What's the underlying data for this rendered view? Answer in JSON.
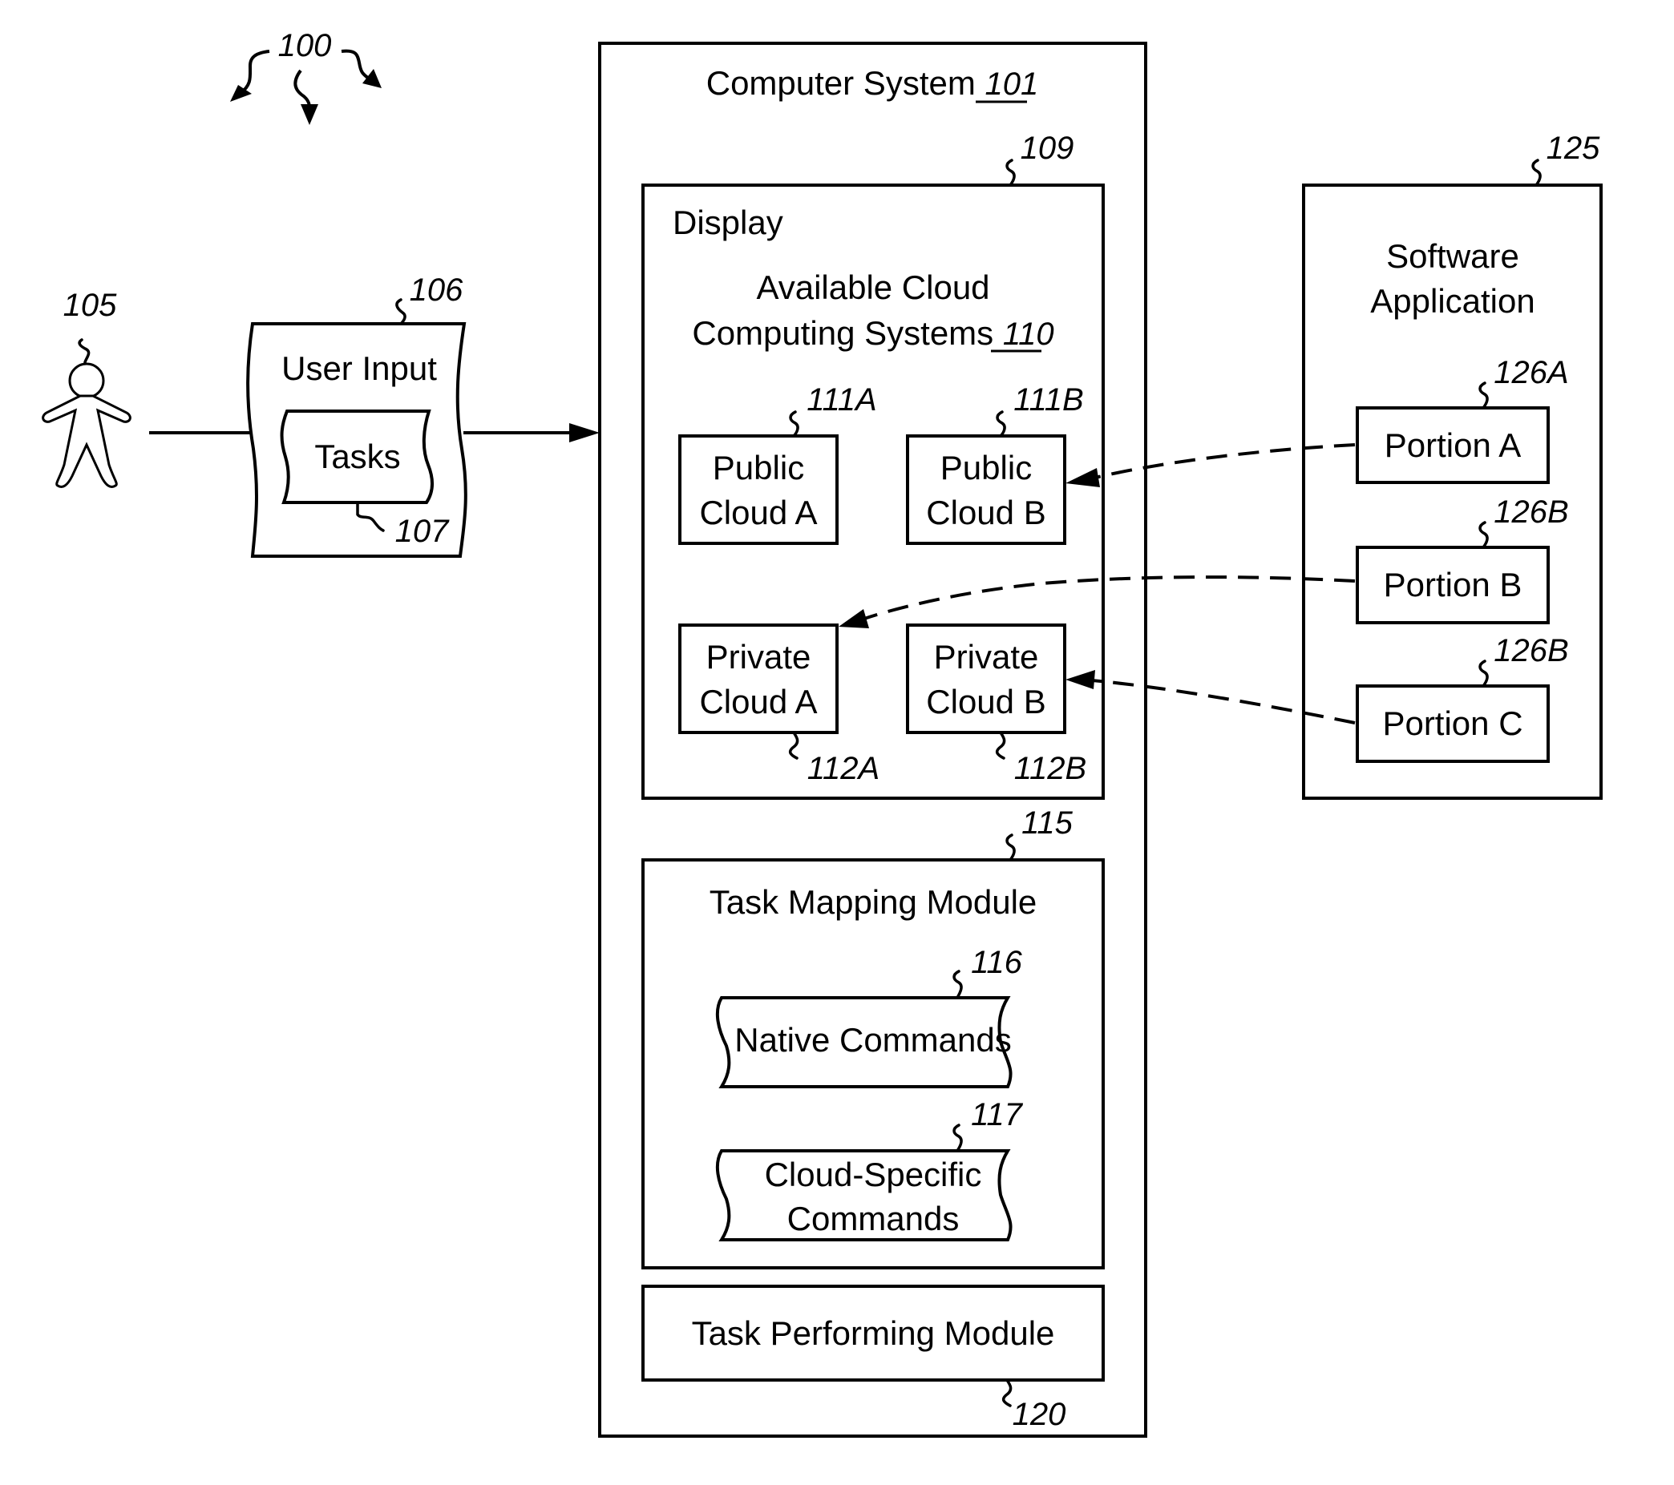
{
  "figure": {
    "ref": "100"
  },
  "user": {
    "ref": "105",
    "icon": "person-icon"
  },
  "user_input": {
    "label": "User Input",
    "ref": "106",
    "tasks": {
      "label": "Tasks",
      "ref": "107"
    }
  },
  "computer_system": {
    "label": "Computer System",
    "ref": "101",
    "display": {
      "label": "Display",
      "ref": "109",
      "available": {
        "line1": "Available Cloud",
        "line2": "Computing Systems",
        "ref": "110"
      },
      "clouds": [
        {
          "line1": "Public",
          "line2": "Cloud A",
          "ref": "111A"
        },
        {
          "line1": "Public",
          "line2": "Cloud B",
          "ref": "111B"
        },
        {
          "line1": "Private",
          "line2": "Cloud A",
          "ref": "112A"
        },
        {
          "line1": "Private",
          "line2": "Cloud B",
          "ref": "112B"
        }
      ]
    },
    "task_mapping": {
      "label": "Task Mapping Module",
      "ref": "115",
      "native": {
        "label": "Native Commands",
        "ref": "116"
      },
      "cloud_specific": {
        "line1": "Cloud-Specific",
        "line2": "Commands",
        "ref": "117"
      }
    },
    "task_performing": {
      "label": "Task Performing Module",
      "ref": "120"
    }
  },
  "software_app": {
    "line1": "Software",
    "line2": "Application",
    "ref": "125",
    "portions": [
      {
        "label": "Portion A",
        "ref": "126A",
        "target": "Public Cloud B"
      },
      {
        "label": "Portion B",
        "ref": "126B",
        "target": "Private Cloud A"
      },
      {
        "label": "Portion C",
        "ref": "126B",
        "target": "Private Cloud B"
      }
    ]
  }
}
